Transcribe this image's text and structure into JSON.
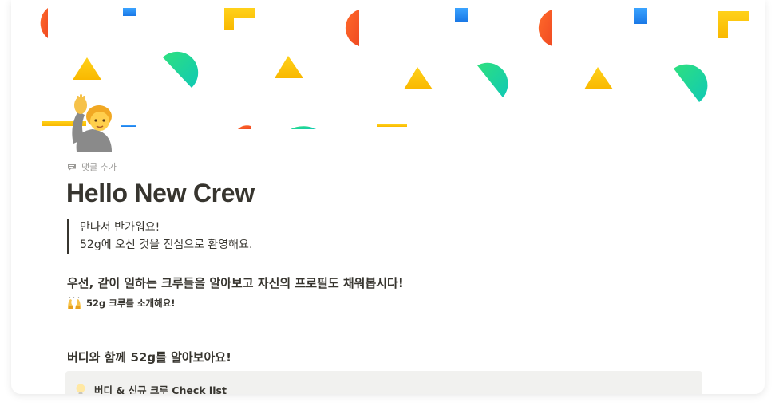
{
  "page": {
    "comment_label": "댓글 추가",
    "title": "Hello New Crew",
    "quote_line1": "만나서 반가워요!",
    "quote_line2": "52g에 오신 것을 진심으로 환영해요.",
    "heading_intro": "우선, 같이 일하는 크루들을 알아보고 자신의 프로필도 채워봅시다!",
    "crew_link_label": "52g 크루를 소개해요!",
    "heading_buddy": "버디와 함께 52g를 알아보아요!",
    "callout_text": "버디 & 신규 크루 Check list"
  },
  "icons": {
    "comment": "comment-icon",
    "avatar": "raising-hand-person-emoji",
    "crew_link": "raised-hands-emoji",
    "callout": "lightbulb-icon"
  },
  "colors": {
    "text": "#37352f",
    "muted": "#9b9a97",
    "callout_bg": "#f1f1ef",
    "confetti_red": "#f5582a",
    "confetti_yellow": "#ffc107",
    "confetti_green": "#1ecf9a",
    "confetti_blue": "#2d8ff0"
  }
}
